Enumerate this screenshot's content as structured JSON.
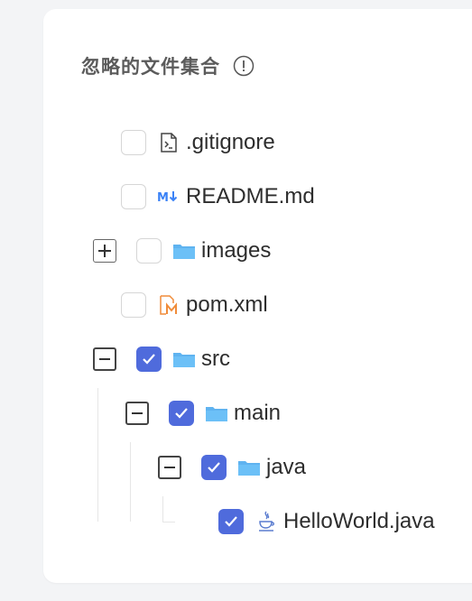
{
  "panel": {
    "title": "忽略的文件集合",
    "info_icon": "info-circle-icon"
  },
  "tree": [
    {
      "label": ".gitignore",
      "icon": "terminal-file-icon",
      "checked": false,
      "expander": "none"
    },
    {
      "label": "README.md",
      "icon": "markdown-icon",
      "checked": false,
      "expander": "none"
    },
    {
      "label": "images",
      "icon": "folder-icon",
      "checked": false,
      "expander": "collapsed"
    },
    {
      "label": "pom.xml",
      "icon": "maven-icon",
      "checked": false,
      "expander": "none"
    },
    {
      "label": "src",
      "icon": "folder-icon",
      "checked": true,
      "expander": "expanded"
    },
    {
      "label": "main",
      "icon": "folder-icon",
      "checked": true,
      "expander": "expanded"
    },
    {
      "label": "java",
      "icon": "folder-icon",
      "checked": true,
      "expander": "expanded"
    },
    {
      "label": "HelloWorld.java",
      "icon": "java-icon",
      "checked": true,
      "expander": "none"
    }
  ],
  "colors": {
    "checkbox_checked": "#4f6bdc",
    "folder": "#5fb3f0",
    "markdown": "#3b82f6",
    "maven": "#f08c3a",
    "java": "#5a7ccf"
  }
}
